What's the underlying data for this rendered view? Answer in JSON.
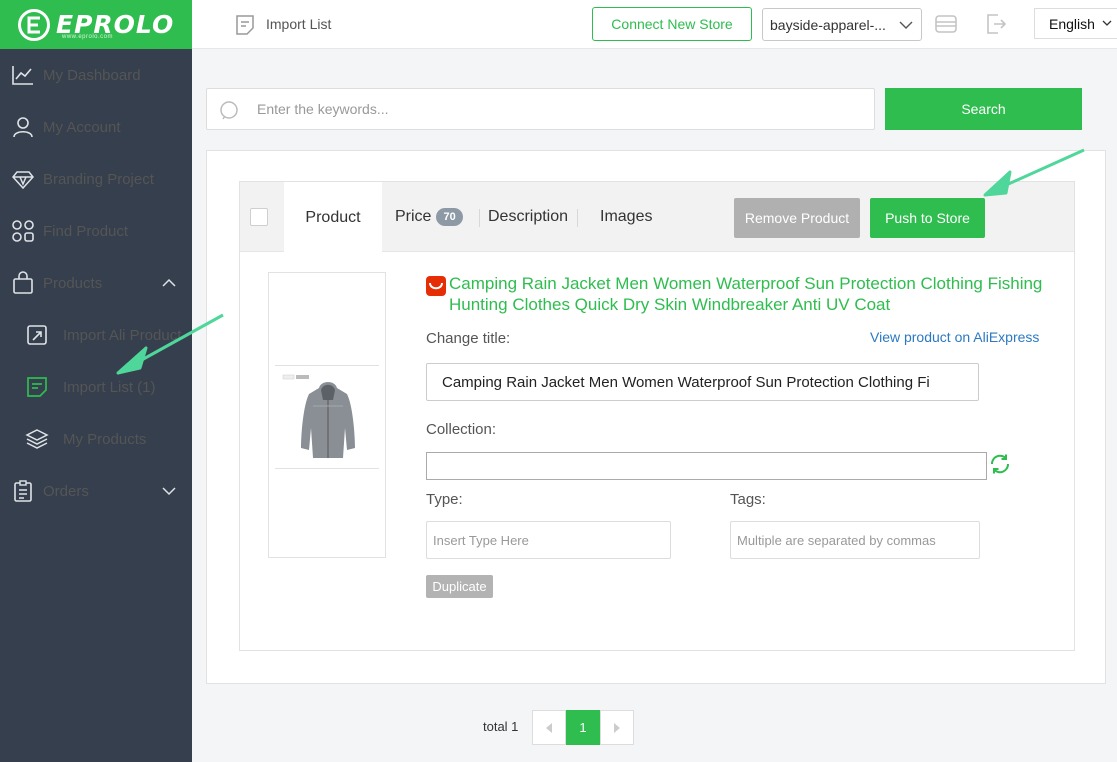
{
  "brand": {
    "name": "EPROLO",
    "site": "www.eprolo.com",
    "accent": "#2ebd4e",
    "sidebar_bg": "#363f4d"
  },
  "sidebar": {
    "items": [
      {
        "label": "My Dashboard",
        "icon": "chart-line-icon"
      },
      {
        "label": "My Account",
        "icon": "user-icon"
      },
      {
        "label": "Branding Project",
        "icon": "diamond-icon"
      },
      {
        "label": "Find Product",
        "icon": "grid-icon"
      },
      {
        "label": "Products",
        "icon": "bag-icon",
        "expanded": true
      },
      {
        "label": "Import Ali Product",
        "icon": "import-icon",
        "sub": true
      },
      {
        "label": "Import List (1)",
        "icon": "list-icon",
        "sub": true,
        "active": true
      },
      {
        "label": "My Products",
        "icon": "layers-icon",
        "sub": true
      },
      {
        "label": "Orders",
        "icon": "clipboard-icon",
        "expanded": false
      }
    ]
  },
  "header": {
    "page_title": "Import List",
    "connect_label": "Connect New Store",
    "store_selected": "bayside-apparel-...",
    "language": "English"
  },
  "search": {
    "placeholder": "Enter the keywords...",
    "button_label": "Search"
  },
  "card": {
    "tabs": [
      {
        "label": "Product",
        "active": true
      },
      {
        "label": "Price",
        "badge": "70"
      },
      {
        "label": "Description"
      },
      {
        "label": "Images"
      }
    ],
    "remove_label": "Remove Product",
    "push_label": "Push to Store",
    "product_title": "Camping Rain Jacket Men Women Waterproof Sun Protection Clothing Fishing Hunting Clothes Quick Dry Skin Windbreaker Anti UV Coat",
    "change_title_label": "Change title:",
    "view_link": "View product on AliExpress",
    "title_value": "Camping Rain Jacket Men Women Waterproof Sun Protection Clothing Fi",
    "collection_label": "Collection:",
    "collection_value": "",
    "type_label": "Type:",
    "type_placeholder": "Insert Type Here",
    "tags_label": "Tags:",
    "tags_placeholder": "Multiple are separated by commas",
    "duplicate_label": "Duplicate"
  },
  "pagination": {
    "total_label": "total 1",
    "current_page": "1"
  }
}
